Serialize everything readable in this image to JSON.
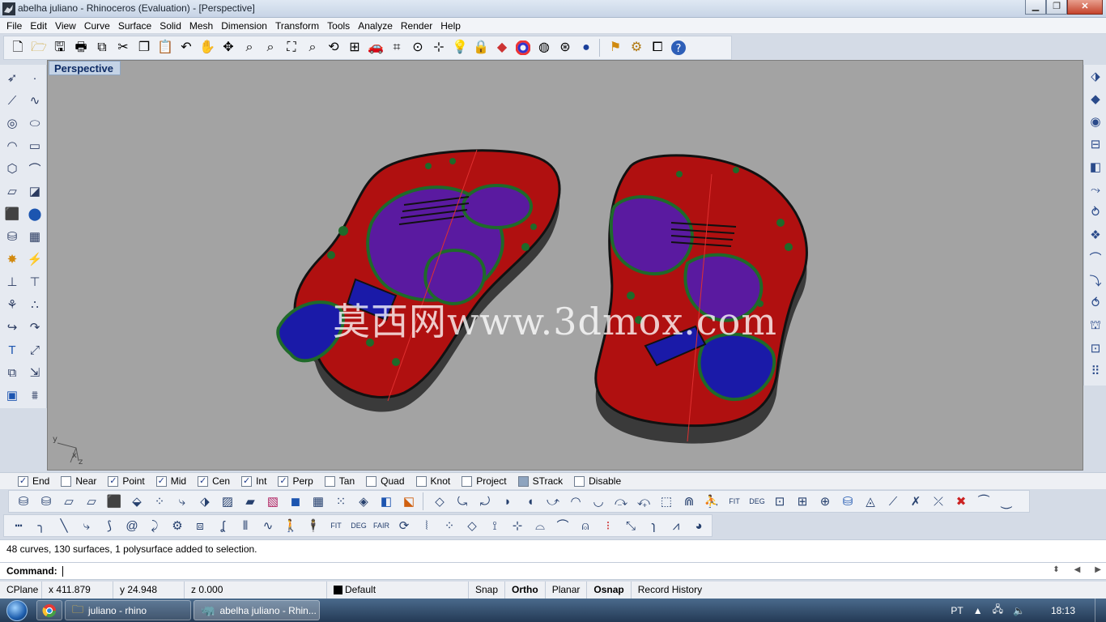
{
  "window": {
    "title": "abelha juliano - Rhinoceros (Evaluation) - [Perspective]"
  },
  "menu": [
    "File",
    "Edit",
    "View",
    "Curve",
    "Surface",
    "Solid",
    "Mesh",
    "Dimension",
    "Transform",
    "Tools",
    "Analyze",
    "Render",
    "Help"
  ],
  "std_toolbar": [
    "new-icon",
    "open-icon",
    "save-icon",
    "print-icon",
    "import-icon",
    "cut-icon",
    "copy-icon",
    "paste-icon",
    "undo-icon",
    "pan-icon",
    "rotate-view-icon",
    "zoom-icon",
    "zoom-window-icon",
    "zoom-extents-icon",
    "zoom-selected-icon",
    "rotate-icon",
    "four-viewports-icon",
    "car-icon",
    "grid-icon",
    "target-icon",
    "select-points-icon",
    "light-icon",
    "lock-icon",
    "layer-icon",
    "color-wheel-icon",
    "sphere-wire-icon",
    "mesh-sphere-icon",
    "render-sphere-icon",
    "flag-icon",
    "gear-icon",
    "properties-icon",
    "help-icon"
  ],
  "viewport": {
    "label": "Perspective",
    "watermark": "莫西网www.3dmox.com",
    "axes": {
      "y": "y",
      "x": "x",
      "z": "z"
    }
  },
  "osnap": [
    {
      "label": "End",
      "checked": true
    },
    {
      "label": "Near",
      "checked": false
    },
    {
      "label": "Point",
      "checked": true
    },
    {
      "label": "Mid",
      "checked": true
    },
    {
      "label": "Cen",
      "checked": true
    },
    {
      "label": "Int",
      "checked": true
    },
    {
      "label": "Perp",
      "checked": true
    },
    {
      "label": "Tan",
      "checked": false
    },
    {
      "label": "Quad",
      "checked": false
    },
    {
      "label": "Knot",
      "checked": false
    },
    {
      "label": "Project",
      "checked": false
    },
    {
      "label": "STrack",
      "checked": false
    },
    {
      "label": "Disable",
      "checked": false
    }
  ],
  "command": {
    "history": "48 curves, 130 surfaces, 1 polysurface added to selection.",
    "prompt": "Command:"
  },
  "status": {
    "cplane": "CPlane",
    "x": "x 411.879",
    "y": "y 24.948",
    "z": "z 0.000",
    "layer": "Default",
    "snap": "Snap",
    "ortho": "Ortho",
    "planar": "Planar",
    "osnap": "Osnap",
    "record": "Record History"
  },
  "taskbar": {
    "items": [
      "juliano - rhino",
      "abelha juliano - Rhin..."
    ],
    "lang": "PT",
    "time": "18:13"
  },
  "colors": {
    "insole_red": "#b01010",
    "insole_purple": "#5a1aa0",
    "insole_blue": "#1a1aa8",
    "insole_green": "#1f6a2a",
    "viewport_bg": "#a3a3a3"
  }
}
